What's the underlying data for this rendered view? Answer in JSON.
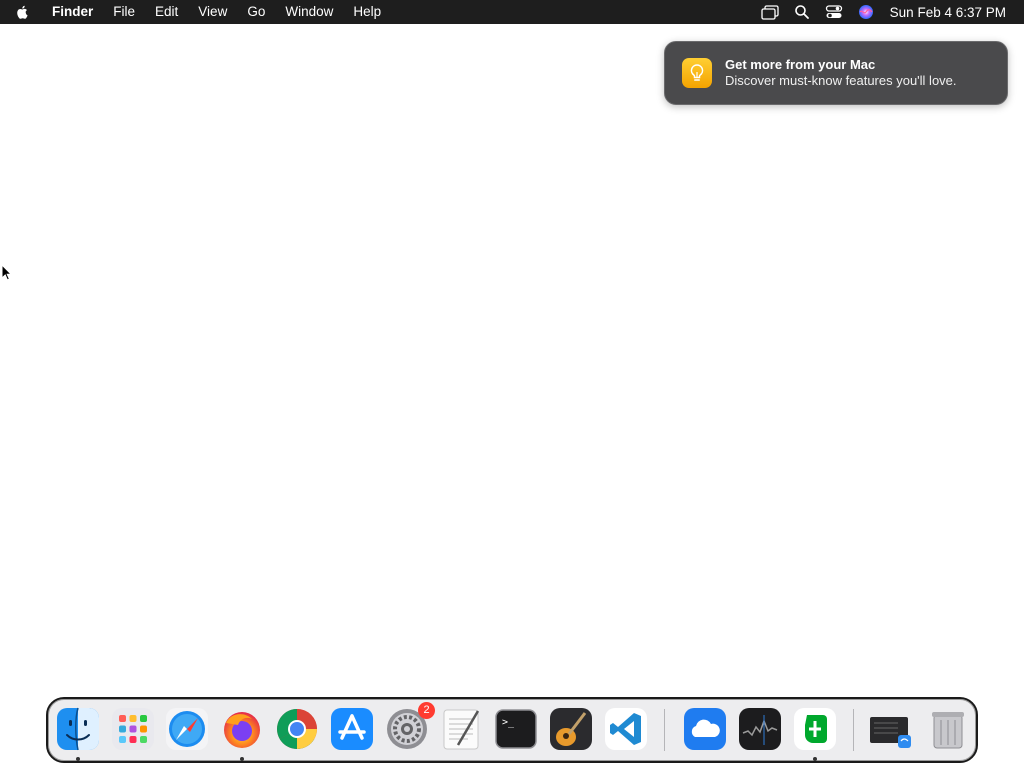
{
  "menubar": {
    "app_name": "Finder",
    "menus": [
      "File",
      "Edit",
      "View",
      "Go",
      "Window",
      "Help"
    ],
    "status_icons": [
      "screen-mirroring-icon",
      "spotlight-search-icon",
      "control-center-icon",
      "siri-icon"
    ],
    "clock": "Sun Feb 4  6:37 PM"
  },
  "notification": {
    "title": "Get more from your Mac",
    "body": "Discover must-know features you'll love.",
    "icon": "lightbulb-icon"
  },
  "dock": {
    "apps": [
      {
        "name": "Finder",
        "running": true
      },
      {
        "name": "Launchpad",
        "running": false
      },
      {
        "name": "Safari",
        "running": false
      },
      {
        "name": "Firefox",
        "running": true
      },
      {
        "name": "Google Chrome",
        "running": false
      },
      {
        "name": "App Store",
        "running": false
      },
      {
        "name": "System Settings",
        "running": false,
        "badge": "2"
      },
      {
        "name": "TextEdit",
        "running": false
      },
      {
        "name": "Terminal",
        "running": false
      },
      {
        "name": "GarageBand",
        "running": false
      },
      {
        "name": "Visual Studio Code",
        "running": false
      },
      {
        "name": "iCloud Drive",
        "running": false
      },
      {
        "name": "Stocks",
        "running": false
      },
      {
        "name": "Evernote",
        "running": true
      }
    ],
    "others": [
      {
        "name": "Downloads"
      },
      {
        "name": "Trash"
      }
    ]
  }
}
